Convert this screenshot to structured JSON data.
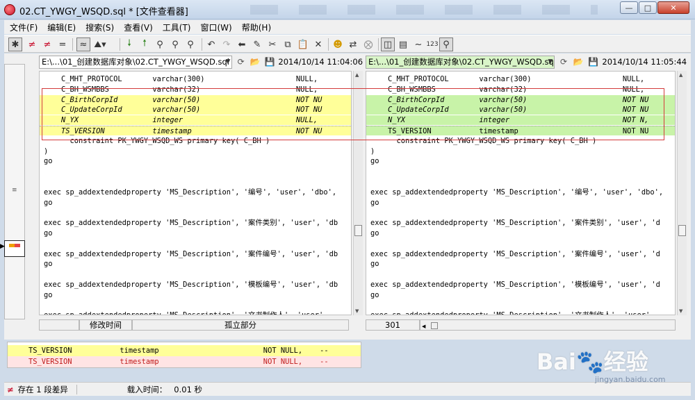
{
  "window": {
    "title": "02.CT_YWGY_WSQD.sql * [文件查看器]"
  },
  "menu": [
    "文件(F)",
    "编辑(E)",
    "搜索(S)",
    "查看(V)",
    "工具(T)",
    "窗口(W)",
    "帮助(H)"
  ],
  "toolbar": {
    "icons": [
      "star-icon",
      "not-equal-icon",
      "not-equal-icon",
      "equal-icon",
      "approx-icon",
      "filter-icon",
      "arrow-down-icon",
      "arrow-up-icon",
      "binoculars-icon",
      "binoculars-next-icon",
      "binoculars-prev-icon",
      "undo-icon",
      "redo-icon",
      "arrow-left-icon",
      "pencil-icon",
      "scissors-icon",
      "copy-icon",
      "paste-icon",
      "delete-icon",
      "face-icon",
      "swap-icon",
      "stop-icon",
      "pane-split-icon",
      "pane-horizontal-icon",
      "tilde-icon",
      "number-icon",
      "search-icon"
    ],
    "tilde_label": "~",
    "number_label": "123"
  },
  "left": {
    "path": "E:\\...\\01_创建数据库对象\\02.CT_YWGY_WSQD.sql",
    "date": "2014/10/14 11:04:06",
    "lines": [
      {
        "text": "    C_MHT_PROTOCOL       varchar(300)                     NULL,",
        "style": "normal"
      },
      {
        "text": "    C_BH_WSMBBS          varchar(32)                      NULL,",
        "style": "normal"
      },
      {
        "text": "    C_BirthCorpId        varchar(50)                      NOT NU",
        "style": "diff-italic"
      },
      {
        "text": "    C_UpdateCorpId       varchar(50)                      NOT NU",
        "style": "diff-italic"
      },
      {
        "text": "    N_YX                 integer                          NULL,",
        "style": "diff-italic"
      },
      {
        "text": "    TS_VERSION           timestamp                        NOT NU",
        "style": "diff-italic-dotted"
      },
      {
        "text": "      constraint PK_YWGY_WSQD_WS primary key( C_BH )",
        "style": "normal"
      },
      {
        "text": ")",
        "style": "normal"
      },
      {
        "text": "go",
        "style": "normal"
      },
      {
        "text": "",
        "style": "normal"
      },
      {
        "text": "",
        "style": "normal"
      },
      {
        "text": "exec sp_addextendedproperty 'MS_Description', '编号', 'user', 'dbo',",
        "style": "normal"
      },
      {
        "text": "go",
        "style": "normal"
      },
      {
        "text": "",
        "style": "normal"
      },
      {
        "text": "exec sp_addextendedproperty 'MS_Description', '案件类别', 'user', 'db",
        "style": "normal"
      },
      {
        "text": "go",
        "style": "normal"
      },
      {
        "text": "",
        "style": "normal"
      },
      {
        "text": "exec sp_addextendedproperty 'MS_Description', '案件编号', 'user', 'db",
        "style": "normal"
      },
      {
        "text": "go",
        "style": "normal"
      },
      {
        "text": "",
        "style": "normal"
      },
      {
        "text": "exec sp_addextendedproperty 'MS_Description', '模板编号', 'user', 'db",
        "style": "normal"
      },
      {
        "text": "go",
        "style": "normal"
      },
      {
        "text": "",
        "style": "normal"
      },
      {
        "text": "exec sp_addextendedproperty 'MS_Description', '文书制作人', 'user',",
        "style": "normal"
      }
    ],
    "status": [
      "修改时间",
      "孤立部分"
    ]
  },
  "right": {
    "path": "E:\\...\\01_创建数据库对象\\02.CT_YWGY_WSQD.sql",
    "date": "2014/10/14 11:05:44",
    "lines": [
      {
        "text": "    C_MHT_PROTOCOL       varchar(300)                     NULL,",
        "style": "normal"
      },
      {
        "text": "    C_BH_WSMBBS          varchar(32)                      NULL,",
        "style": "normal"
      },
      {
        "text": "    C_BirthCorpId        varchar(50)                      NOT NU",
        "style": "diff-italic"
      },
      {
        "text": "    C_UpdateCorpId       varchar(50)                      NOT NU",
        "style": "diff-italic"
      },
      {
        "text": "    N_YX                 integer                          NOT N,",
        "style": "diff-italic"
      },
      {
        "text": "    TS_VERSION           timestamp                        NOT NU",
        "style": "diff-dotted"
      },
      {
        "text": "      constraint PK_YWGY_WSQD_WS primary key( C_BH )",
        "style": "normal"
      },
      {
        "text": ")",
        "style": "normal"
      },
      {
        "text": "go",
        "style": "normal"
      },
      {
        "text": "",
        "style": "normal"
      },
      {
        "text": "",
        "style": "normal"
      },
      {
        "text": "exec sp_addextendedproperty 'MS_Description', '编号', 'user', 'dbo',",
        "style": "normal"
      },
      {
        "text": "go",
        "style": "normal"
      },
      {
        "text": "",
        "style": "normal"
      },
      {
        "text": "exec sp_addextendedproperty 'MS_Description', '案件类别', 'user', 'd",
        "style": "normal"
      },
      {
        "text": "go",
        "style": "normal"
      },
      {
        "text": "",
        "style": "normal"
      },
      {
        "text": "exec sp_addextendedproperty 'MS_Description', '案件编号', 'user', 'd",
        "style": "normal"
      },
      {
        "text": "go",
        "style": "normal"
      },
      {
        "text": "",
        "style": "normal"
      },
      {
        "text": "exec sp_addextendedproperty 'MS_Description', '模板编号', 'user', 'd",
        "style": "normal"
      },
      {
        "text": "go",
        "style": "normal"
      },
      {
        "text": "",
        "style": "normal"
      },
      {
        "text": "exec sp_addextendedproperty 'MS_Description', '文书制作人', 'user',",
        "style": "normal"
      }
    ],
    "status": [
      "301"
    ]
  },
  "compare": {
    "line1": "TS_VERSION           timestamp                        NOT NULL,    --",
    "line2": "TS_VERSION           timestamp                        NOT NULL,    --"
  },
  "statusbar": {
    "diff_count": "存在 1 段差异",
    "load_time_label": "载入时间：",
    "load_time_value": "0.01 秒"
  },
  "watermark": {
    "brand": "Bai🐾经验",
    "url": "jingyan.baidu.com"
  },
  "colors": {
    "left_diff": "#ffff99",
    "right_diff": "#c8f3a8",
    "compare_removed": "#ffe4e4",
    "diff_box": "#d43b3b"
  }
}
